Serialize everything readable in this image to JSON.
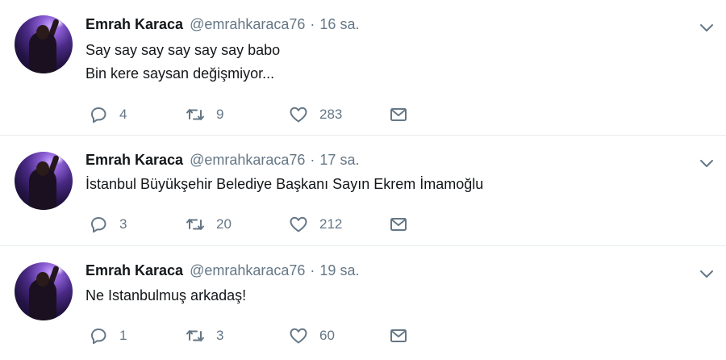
{
  "tweets": [
    {
      "name": "Emrah Karaca",
      "handle": "@emrahkaraca76",
      "separator": "·",
      "time": "16 sa.",
      "lines": [
        "Say say say say say say babo",
        "Bin kere saysan değişmiyor..."
      ],
      "replies": "4",
      "retweets": "9",
      "likes": "283"
    },
    {
      "name": "Emrah Karaca",
      "handle": "@emrahkaraca76",
      "separator": "·",
      "time": "17 sa.",
      "lines": [
        "İstanbul Büyükşehir Belediye Başkanı Sayın Ekrem İmamoğlu"
      ],
      "replies": "3",
      "retweets": "20",
      "likes": "212"
    },
    {
      "name": "Emrah Karaca",
      "handle": "@emrahkaraca76",
      "separator": "·",
      "time": "19 sa.",
      "lines": [
        "Ne Istanbulmuş arkadaş!"
      ],
      "replies": "1",
      "retweets": "3",
      "likes": "60"
    }
  ],
  "icons": {
    "reply": "reply-icon",
    "retweet": "retweet-icon",
    "like": "heart-icon",
    "dm": "envelope-icon",
    "more": "chevron-down-icon"
  },
  "colors": {
    "text": "#14171a",
    "secondary": "#657786",
    "divider": "#e6ecf0"
  }
}
